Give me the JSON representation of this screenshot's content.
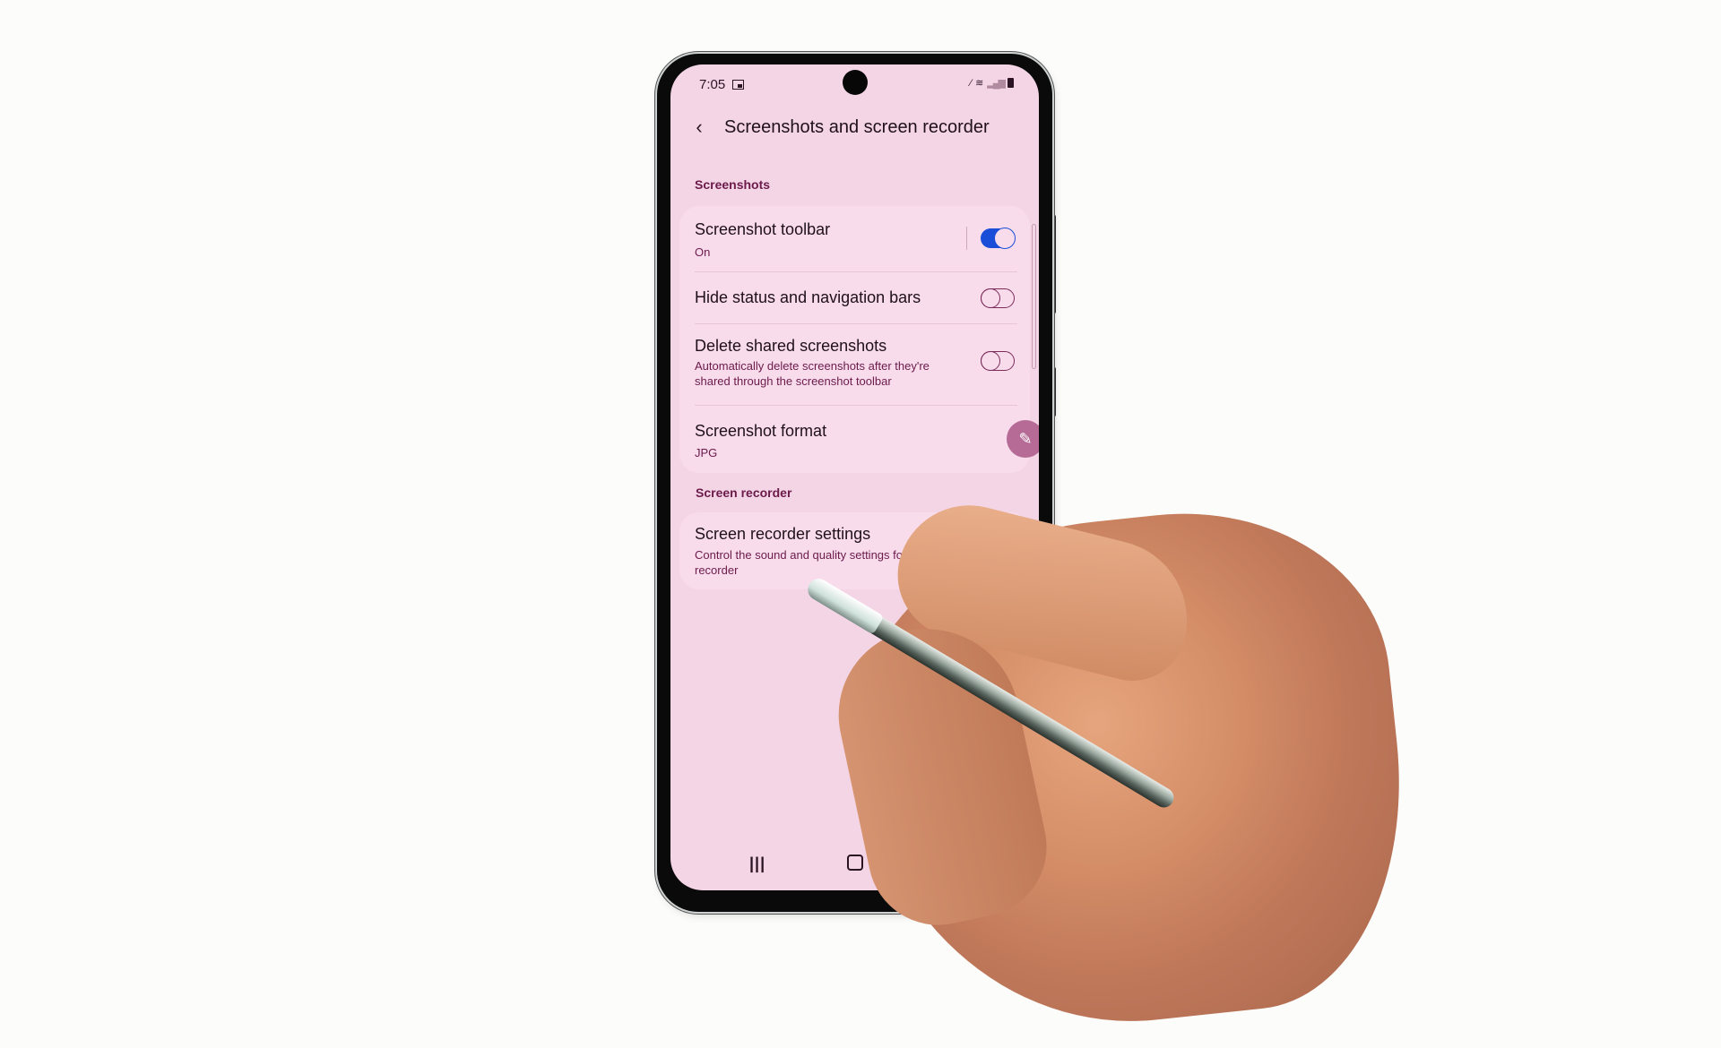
{
  "status_bar": {
    "time": "7:05",
    "icons": [
      "screenshot-notification-icon",
      "spen-icon",
      "wifi-icon",
      "signal-icon",
      "battery-icon"
    ]
  },
  "header": {
    "back_icon": "chevron-left",
    "back_glyph": "‹",
    "title": "Screenshots and screen recorder"
  },
  "sections": [
    {
      "label": "Screenshots",
      "items": [
        {
          "title": "Screenshot toolbar",
          "subtitle": "On",
          "control": "toggle",
          "state": "on"
        },
        {
          "title": "Hide status and navigation bars",
          "subtitle": "",
          "control": "toggle",
          "state": "off"
        },
        {
          "title": "Delete shared screenshots",
          "subtitle": "Automatically delete screenshots after they're shared through the screenshot toolbar",
          "subtitle_line1": "Automatically delete screenshots after they're",
          "subtitle_line2": "shared through the screenshot toolbar",
          "control": "toggle",
          "state": "off"
        },
        {
          "title": "Screenshot format",
          "subtitle": "JPG",
          "control": "none"
        }
      ]
    },
    {
      "label": "Screen recorder",
      "items": [
        {
          "title": "Screen recorder settings",
          "subtitle_line1": "Control the sound and quality settings for the screen",
          "subtitle_line2": "recorder",
          "control": "none"
        }
      ]
    }
  ],
  "floating": {
    "edit_icon": "pencil-icon",
    "edit_glyph": "✎"
  },
  "nav_bar": {
    "recents_glyph": "|||",
    "home_icon": "home-icon",
    "back_icon": "back-icon"
  },
  "colors": {
    "screen_bg": "#f4d5e6",
    "accent_toggle": "#1a4ed8",
    "section_label": "#6b1a4a",
    "fab": "#b56b96"
  }
}
